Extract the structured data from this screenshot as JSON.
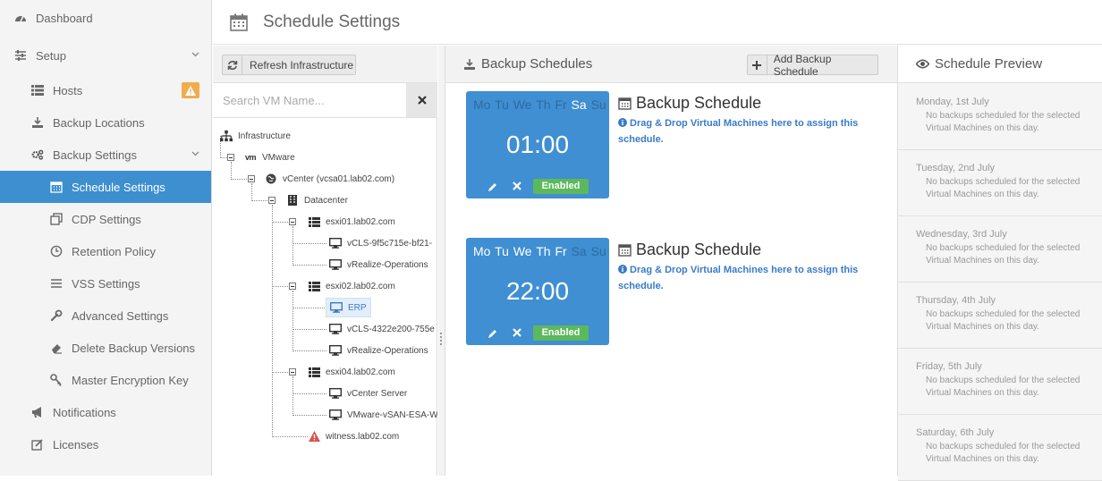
{
  "sidebar": {
    "items": [
      {
        "label": "Dashboard"
      },
      {
        "label": "Setup"
      },
      {
        "label": "Hosts"
      },
      {
        "label": "Backup Locations"
      },
      {
        "label": "Backup Settings"
      },
      {
        "label": "Schedule Settings"
      },
      {
        "label": "CDP Settings"
      },
      {
        "label": "Retention Policy"
      },
      {
        "label": "VSS Settings"
      },
      {
        "label": "Advanced Settings"
      },
      {
        "label": "Delete Backup Versions"
      },
      {
        "label": "Master Encryption Key"
      },
      {
        "label": "Notifications"
      },
      {
        "label": "Licenses"
      }
    ]
  },
  "header": {
    "title": "Schedule Settings"
  },
  "tree_panel": {
    "refresh_label": "Refresh Infrastructure",
    "search_placeholder": "Search VM Name...",
    "nodes": [
      {
        "label": "Infrastructure"
      },
      {
        "label": "VMware"
      },
      {
        "label": "vCenter (vcsa01.lab02.com)"
      },
      {
        "label": "Datacenter"
      },
      {
        "label": "esxi01.lab02.com"
      },
      {
        "label": "vCLS-9f5c715e-bf21-"
      },
      {
        "label": "vRealize-Operations"
      },
      {
        "label": "esxi02.lab02.com"
      },
      {
        "label": "ERP"
      },
      {
        "label": "vCLS-4322e200-755e"
      },
      {
        "label": "vRealize-Operations"
      },
      {
        "label": "esxi04.lab02.com"
      },
      {
        "label": "vCenter Server"
      },
      {
        "label": "VMware-vSAN-ESA-W"
      },
      {
        "label": "witness.lab02.com"
      }
    ]
  },
  "schedules_panel": {
    "title": "Backup Schedules",
    "add_label": "Add Backup Schedule",
    "day_letters": [
      "Mo",
      "Tu",
      "We",
      "Th",
      "Fr",
      "Sa",
      "Su"
    ],
    "items": [
      {
        "time": "01:00",
        "name": "Backup Schedule",
        "status": "Enabled",
        "hint": "Drag & Drop Virtual Machines here to assign this schedule.",
        "days_on": [
          false,
          false,
          false,
          false,
          false,
          true,
          false
        ]
      },
      {
        "time": "22:00",
        "name": "Backup Schedule",
        "status": "Enabled",
        "hint": "Drag & Drop Virtual Machines here to assign this schedule.",
        "days_on": [
          true,
          true,
          true,
          true,
          true,
          false,
          false
        ]
      }
    ]
  },
  "preview_panel": {
    "title": "Schedule Preview",
    "days": [
      {
        "name": "Monday, 1st July",
        "message": "No backups scheduled for the selected Virtual Machines on this day."
      },
      {
        "name": "Tuesday, 2nd July",
        "message": "No backups scheduled for the selected Virtual Machines on this day."
      },
      {
        "name": "Wednesday, 3rd July",
        "message": "No backups scheduled for the selected Virtual Machines on this day."
      },
      {
        "name": "Thursday, 4th July",
        "message": "No backups scheduled for the selected Virtual Machines on this day."
      },
      {
        "name": "Friday, 5th July",
        "message": "No backups scheduled for the selected Virtual Machines on this day."
      },
      {
        "name": "Saturday, 6th July",
        "message": "No backups scheduled for the selected Virtual Machines on this day."
      }
    ]
  },
  "colors": {
    "accent": "#3d8fd0",
    "card": "#3f8fd2",
    "enabled": "#5cb85c",
    "warning": "#f0ad4e",
    "error": "#d9534f"
  }
}
